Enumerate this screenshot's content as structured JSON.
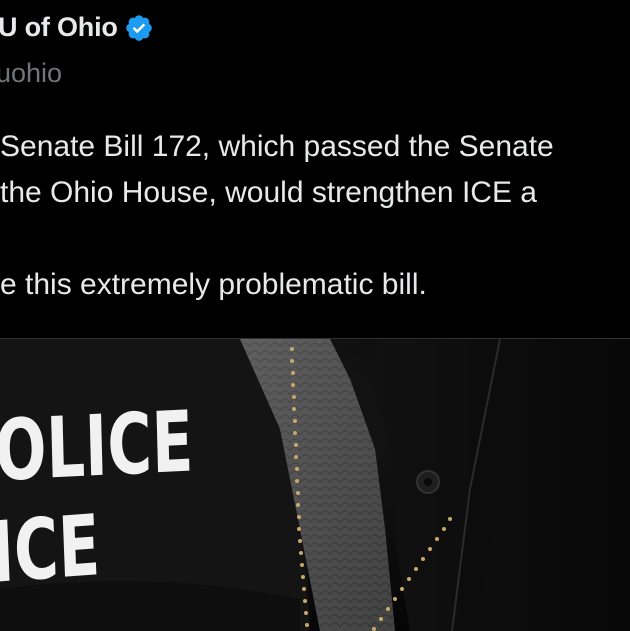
{
  "account": {
    "display_name": "U of Ohio",
    "handle": "uohio",
    "verified_icon": "verified-badge-icon",
    "verified_color": "#1d9bf0"
  },
  "tweet": {
    "line1": "Senate Bill 172, which passed the Senate",
    "line2": "the Ohio House, would strengthen ICE a",
    "line3": "e this extremely problematic bill."
  },
  "media": {
    "jacket_line1": "OLICE",
    "jacket_line2": "ICE"
  }
}
